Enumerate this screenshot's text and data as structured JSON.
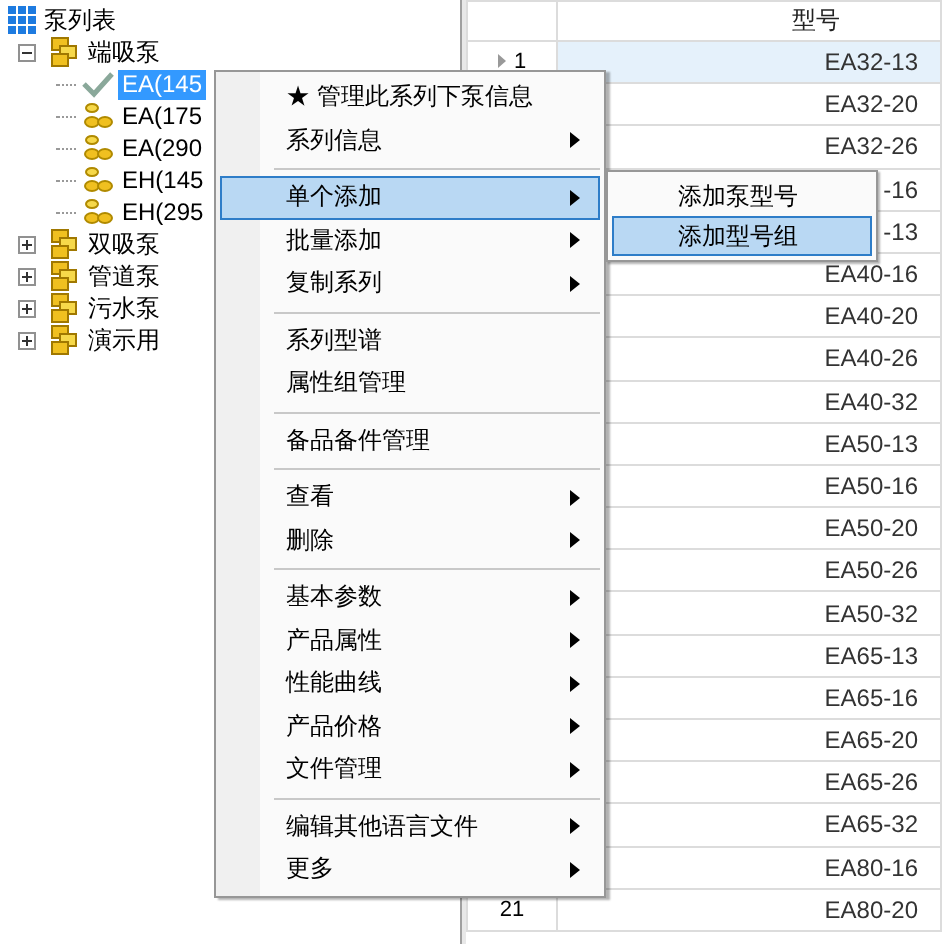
{
  "tree": {
    "label": "泵列表",
    "kind": "root",
    "children": [
      {
        "label": "端吸泵",
        "kind": "group",
        "expanded": true,
        "children": [
          {
            "label": "EA(145",
            "kind": "series",
            "selected": true,
            "checked": true
          },
          {
            "label": "EA(175",
            "kind": "series",
            "selected": false,
            "checked": false
          },
          {
            "label": "EA(290",
            "kind": "series",
            "selected": false,
            "checked": false
          },
          {
            "label": "EH(145",
            "kind": "series",
            "selected": false,
            "checked": false
          },
          {
            "label": "EH(295",
            "kind": "series",
            "selected": false,
            "checked": false
          }
        ]
      },
      {
        "label": "双吸泵",
        "kind": "group",
        "expanded": false
      },
      {
        "label": "管道泵",
        "kind": "group",
        "expanded": false
      },
      {
        "label": "污水泵",
        "kind": "group",
        "expanded": false
      },
      {
        "label": "演示用",
        "kind": "group",
        "expanded": false
      }
    ]
  },
  "grid": {
    "columns": [
      "型号"
    ],
    "rows": [
      {
        "number": "1",
        "model": "EA32-13",
        "selected": true
      },
      {
        "model": "EA32-20",
        "selected": false
      },
      {
        "model": "EA32-26",
        "selected": false
      },
      {
        "model": "-16",
        "selected": false
      },
      {
        "model": "-13",
        "selected": false
      },
      {
        "model": "EA40-16",
        "selected": false
      },
      {
        "model": "EA40-20",
        "selected": false
      },
      {
        "model": "EA40-26",
        "selected": false
      },
      {
        "model": "EA40-32",
        "selected": false
      },
      {
        "model": "EA50-13",
        "selected": false
      },
      {
        "model": "EA50-16",
        "selected": false
      },
      {
        "model": "EA50-20",
        "selected": false
      },
      {
        "model": "EA50-26",
        "selected": false
      },
      {
        "model": "EA50-32",
        "selected": false
      },
      {
        "model": "EA65-13",
        "selected": false
      },
      {
        "model": "EA65-16",
        "selected": false
      },
      {
        "model": "EA65-20",
        "selected": false
      },
      {
        "model": "EA65-26",
        "selected": false
      },
      {
        "model": "EA65-32",
        "selected": false
      },
      {
        "model": "EA80-16",
        "selected": false
      },
      {
        "number": "21",
        "model": "EA80-20",
        "selected": false
      }
    ]
  },
  "context_menu": {
    "items": [
      {
        "kind": "item",
        "label": "★ 管理此系列下泵信息",
        "submenu": false,
        "selected": false
      },
      {
        "kind": "item",
        "label": "系列信息",
        "submenu": true,
        "selected": false
      },
      {
        "kind": "separator"
      },
      {
        "kind": "item",
        "label": "单个添加",
        "submenu": true,
        "selected": true
      },
      {
        "kind": "item",
        "label": "批量添加",
        "submenu": true,
        "selected": false
      },
      {
        "kind": "item",
        "label": "复制系列",
        "submenu": true,
        "selected": false
      },
      {
        "kind": "separator"
      },
      {
        "kind": "item",
        "label": "系列型谱",
        "submenu": false,
        "selected": false
      },
      {
        "kind": "item",
        "label": "属性组管理",
        "submenu": false,
        "selected": false
      },
      {
        "kind": "separator"
      },
      {
        "kind": "item",
        "label": "备品备件管理",
        "submenu": false,
        "selected": false
      },
      {
        "kind": "separator"
      },
      {
        "kind": "item",
        "label": "查看",
        "submenu": true,
        "selected": false
      },
      {
        "kind": "item",
        "label": "删除",
        "submenu": true,
        "selected": false
      },
      {
        "kind": "separator"
      },
      {
        "kind": "item",
        "label": "基本参数",
        "submenu": true,
        "selected": false
      },
      {
        "kind": "item",
        "label": "产品属性",
        "submenu": true,
        "selected": false
      },
      {
        "kind": "item",
        "label": "性能曲线",
        "submenu": true,
        "selected": false
      },
      {
        "kind": "item",
        "label": "产品价格",
        "submenu": true,
        "selected": false
      },
      {
        "kind": "item",
        "label": "文件管理",
        "submenu": true,
        "selected": false
      },
      {
        "kind": "separator"
      },
      {
        "kind": "item",
        "label": "编辑其他语言文件",
        "submenu": true,
        "selected": false
      },
      {
        "kind": "item",
        "label": "更多",
        "submenu": true,
        "selected": false
      }
    ]
  },
  "submenu": {
    "items": [
      {
        "label": "添加泵型号",
        "selected": false
      },
      {
        "label": "添加型号组",
        "selected": true
      }
    ]
  }
}
